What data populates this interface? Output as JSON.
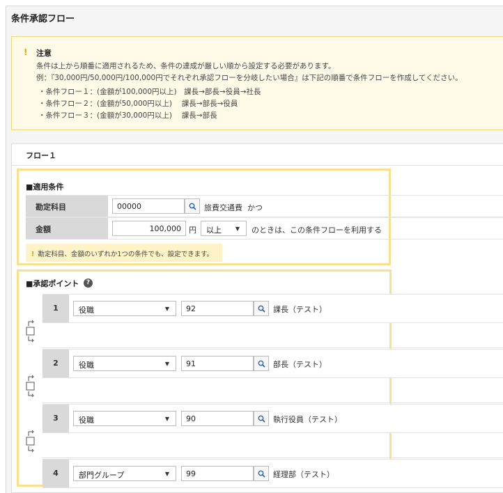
{
  "page": {
    "title": "条件承認フロー"
  },
  "notice": {
    "mark": "!",
    "title": "注意",
    "lines": [
      "条件は上から順番に適用されるため、条件の達成が厳しい順から設定する必要があります。",
      "例：『30,000円/50,000円/100,000円でそれぞれ承認フローを分岐したい場合』は下記の順番で条件フローを作成してください。"
    ],
    "bullets": [
      "・条件フロー１：(金額が100,000円以上)　課長→部長→役員→社長",
      "・条件フロー２：(金額が50,000円以上)　 課長→部長→役員",
      "・条件フロー３：(金額が30,000円以上)　 課長→部長"
    ]
  },
  "flow": {
    "title": "フロー１",
    "condition": {
      "section_title": "■適用条件",
      "account": {
        "label": "勘定科目",
        "value": "00000",
        "name": "旅費交通費",
        "suffix": "かつ"
      },
      "amount": {
        "label": "金額",
        "value": "100,000",
        "unit": "円",
        "operator": "以上",
        "tail": "のときは、この条件フローを利用する"
      },
      "hint": {
        "mark": "!",
        "text": "勘定科目、金額のいずれか1つの条件でも、設定できます。"
      }
    },
    "approval": {
      "section_title": "■承認ポイント",
      "help": "?",
      "steps": [
        {
          "num": "1",
          "type": "役職",
          "code": "92",
          "name": "課長（テスト）"
        },
        {
          "num": "2",
          "type": "役職",
          "code": "91",
          "name": "部長（テスト）"
        },
        {
          "num": "3",
          "type": "役職",
          "code": "90",
          "name": "執行役員（テスト）"
        },
        {
          "num": "4",
          "type": "部門グループ",
          "code": "99",
          "name": "経理部（テスト）"
        }
      ]
    }
  },
  "colors": {
    "highlight_border": "#f8e08e",
    "notice_bg": "#fffbe8",
    "label_bg": "#d9d9d9",
    "warning": "#e0a400"
  }
}
